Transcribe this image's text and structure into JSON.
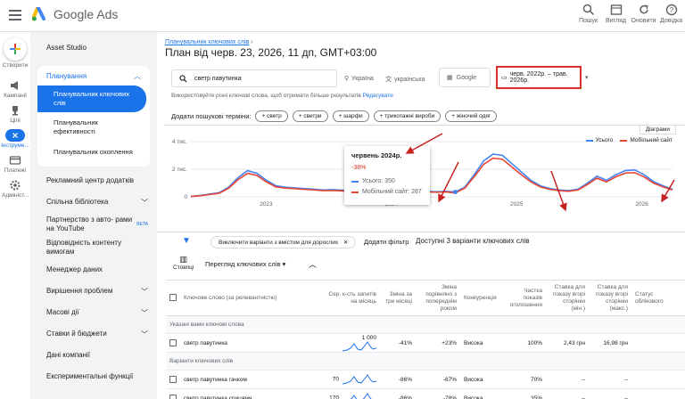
{
  "app": {
    "name": "Google Ads"
  },
  "topbar": {
    "actions": [
      {
        "label": "Пошук",
        "icon": "search-icon"
      },
      {
        "label": "Вигляд",
        "icon": "appearance-icon"
      },
      {
        "label": "Оновити",
        "icon": "refresh-icon"
      },
      {
        "label": "Довідка",
        "icon": "help-icon"
      }
    ]
  },
  "rail": {
    "create": "Створити",
    "items": [
      "Кампанії",
      "Цілі",
      "Інструме...",
      "Платежі",
      "Адмініст..."
    ]
  },
  "nav": {
    "asset_studio": "Asset Studio",
    "planning": "Планування",
    "keyword_planner": "Планувальник ключових слів",
    "performance_planner": "Планувальник ефективності",
    "reach_planner": "Планувальник охоплення",
    "items": [
      {
        "label": "Рекламний центр додатків",
        "chevron": false
      },
      {
        "label": "Спільна бібліотека",
        "chevron": true
      },
      {
        "label": "Партнерство з авто- рами на YouTube",
        "chevron": false,
        "badge": "BETA"
      },
      {
        "label": "Відповідність контенту вимогам",
        "chevron": false
      },
      {
        "label": "Менеджер даних",
        "chevron": false
      },
      {
        "label": "Вирішення проблем",
        "chevron": true
      },
      {
        "label": "Масові дії",
        "chevron": true
      },
      {
        "label": "Ставки й бюджети",
        "chevron": true
      },
      {
        "label": "Дані компанії",
        "chevron": false
      },
      {
        "label": "Експериментальні функції",
        "chevron": false
      }
    ]
  },
  "header": {
    "breadcrumb": "Планувальник ключових слів",
    "title": "План від черв. 23, 2026, 11 дп, GMT+03:00"
  },
  "search": {
    "query": "светр павутинка",
    "location": "Україна",
    "language": "українська",
    "network": "Google",
    "date_range": "черв. 2022р. – трав. 2026р."
  },
  "hint": {
    "text": "Використовуйте різні ключові слова, щоб отримати більше результатів",
    "link": "Редагувати"
  },
  "add_terms": {
    "label": "Додати пошукові терміни:",
    "chips": [
      "светр",
      "светри",
      "шарфи",
      "трикотажні вироби",
      "жіночий одяг"
    ]
  },
  "chart": {
    "download": "Діаграми",
    "legend": [
      {
        "name": "Усього",
        "color": "#4285f4"
      },
      {
        "name": "Мобільний сайт",
        "color": "#ea4335"
      }
    ],
    "y_ticks": [
      "4 тис.",
      "2 тис.",
      "0"
    ],
    "x_ticks": [
      "2023",
      "2024",
      "2025",
      "2026"
    ]
  },
  "chart_data": {
    "type": "line",
    "ylim": [
      0,
      4000
    ],
    "x_ticks": [
      "2023",
      "2024",
      "2025",
      "2026"
    ],
    "series": [
      {
        "name": "Усього",
        "color": "#4285f4",
        "values": [
          30,
          100,
          200,
          300,
          700,
          1400,
          1900,
          1700,
          1200,
          800,
          700,
          650,
          600,
          550,
          500,
          520,
          480,
          420,
          420,
          600,
          1500,
          2300,
          1900,
          1200,
          500,
          400,
          370,
          400,
          350,
          700,
          1600,
          2600,
          3100,
          3000,
          2400,
          1800,
          1200,
          800,
          600,
          500,
          450,
          550,
          1000,
          1500,
          1200,
          1600,
          1900,
          1950,
          1600,
          1100,
          800,
          550
        ]
      },
      {
        "name": "Мобільний сайт",
        "color": "#ea4335",
        "values": [
          20,
          80,
          170,
          260,
          620,
          1250,
          1700,
          1550,
          1080,
          720,
          630,
          590,
          540,
          500,
          450,
          460,
          430,
          380,
          380,
          540,
          1350,
          2100,
          1720,
          1080,
          450,
          360,
          330,
          360,
          287,
          630,
          1450,
          2350,
          2800,
          2720,
          2150,
          1600,
          1080,
          720,
          540,
          450,
          400,
          500,
          900,
          1350,
          1080,
          1450,
          1720,
          1750,
          1440,
          990,
          720,
          500
        ]
      }
    ]
  },
  "tooltip": {
    "title": "червень 2024р.",
    "change": "-38%",
    "total": "Усього: 350",
    "mobile": "Мобільний сайт: 287"
  },
  "filterbar": {
    "chip": "Виключити варіанти з вмістом для дорослих",
    "add_filter": "Додати фільтр",
    "count": "Доступні 3 варіанти ключових слів"
  },
  "toolbar2": {
    "columns": "Стовпці",
    "view": "Перегляд ключових слів"
  },
  "table": {
    "headers": [
      "Ключове слово (за релевантністю)",
      "Сер. к-сть запитів на місяць",
      "Зміна за три місяці",
      "Зміна порівняно з попереднім роком",
      "Конкуренція",
      "Частка показів оголошення",
      "Ставка для показу вгорі сторінки (мін.)",
      "Ставка для показу вгорі сторінки (макс.)",
      "Статус облікового"
    ],
    "section1": "Указані вами ключові слова",
    "section2": "Варіанти ключових слів",
    "rows1": [
      {
        "kw": "светр павутинка",
        "avg": "1 000",
        "three": "-41%",
        "yoy": "+23%",
        "comp": "Висока",
        "share": "100%",
        "low": "2,43 грн",
        "high": "16,98 грн"
      }
    ],
    "rows2": [
      {
        "kw": "светр павутинка гачком",
        "avg": "70",
        "three": "-86%",
        "yoy": "-67%",
        "comp": "Висока",
        "share": "70%",
        "low": "–",
        "high": "–"
      },
      {
        "kw": "светр павутинка спицями",
        "avg": "170",
        "three": "-86%",
        "yoy": "-78%",
        "comp": "Висока",
        "share": "35%",
        "low": "–",
        "high": "–"
      }
    ]
  }
}
